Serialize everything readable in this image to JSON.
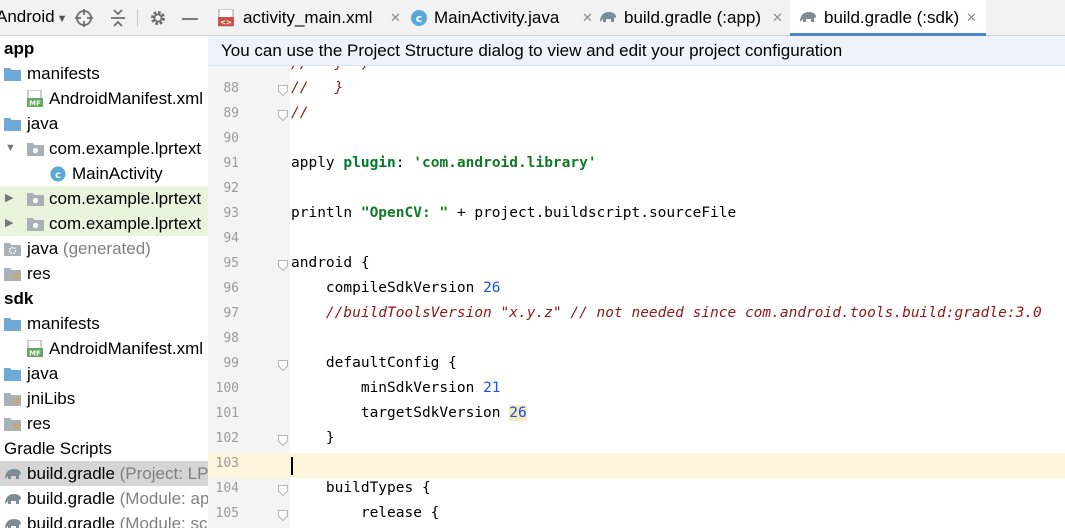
{
  "project_panel": {
    "view_selector": "Android",
    "tree": [
      {
        "label": "app",
        "bold": true
      },
      {
        "label": "manifests",
        "icon": "folder"
      },
      {
        "label": "AndroidManifest.xml",
        "icon": "manifest"
      },
      {
        "label": "java",
        "icon": "folder"
      },
      {
        "label": "com.example.lprtext",
        "icon": "package",
        "expanded": true
      },
      {
        "label": "MainActivity",
        "icon": "class"
      },
      {
        "label": "com.example.lprtext",
        "icon": "package",
        "expanded": false,
        "highlight": true
      },
      {
        "label": "com.example.lprtext",
        "icon": "package",
        "expanded": false,
        "highlight": true
      },
      {
        "label": "java",
        "suffix": "(generated)",
        "icon": "gen-folder"
      },
      {
        "label": "res",
        "icon": "res-folder"
      },
      {
        "label": "sdk",
        "bold": true
      },
      {
        "label": "manifests",
        "icon": "folder"
      },
      {
        "label": "AndroidManifest.xml",
        "icon": "manifest"
      },
      {
        "label": "java",
        "icon": "folder"
      },
      {
        "label": "jniLibs",
        "icon": "res-folder"
      },
      {
        "label": "res",
        "icon": "res-folder"
      },
      {
        "label": "Gradle Scripts"
      },
      {
        "label": "build.gradle",
        "suffix": "(Project: LP",
        "icon": "gradle",
        "selected": true
      },
      {
        "label": "build.gradle",
        "suffix": "(Module: ap",
        "icon": "gradle"
      },
      {
        "label": "build.gradle",
        "suffix": "(Module: sc",
        "icon": "gradle"
      }
    ]
  },
  "tabs": [
    {
      "label": "activity_main.xml",
      "icon": "layout"
    },
    {
      "label": "MainActivity.java",
      "icon": "class"
    },
    {
      "label": "build.gradle (:app)",
      "icon": "gradle"
    },
    {
      "label": "build.gradle (:sdk)",
      "icon": "gradle",
      "active": true
    }
  ],
  "banner": "You can use the Project Structure dialog to view and edit your project configuration",
  "editor": {
    "lines": [
      {
        "n": "88",
        "fold": true,
        "tokens": [
          [
            "cm",
            "//   }"
          ]
        ]
      },
      {
        "n": "89",
        "fold": true,
        "tokens": [
          [
            "cm",
            "//"
          ]
        ]
      },
      {
        "n": "90",
        "tokens": []
      },
      {
        "n": "91",
        "tokens": [
          [
            "pl",
            "apply "
          ],
          [
            "kw",
            "plugin"
          ],
          [
            "pl",
            ": "
          ],
          [
            "str",
            "'com.android.library'"
          ]
        ]
      },
      {
        "n": "92",
        "tokens": []
      },
      {
        "n": "93",
        "tokens": [
          [
            "pl",
            "println "
          ],
          [
            "str",
            "\"OpenCV: \""
          ],
          [
            "pl",
            " + project.buildscript.sourceFile"
          ]
        ]
      },
      {
        "n": "94",
        "tokens": []
      },
      {
        "n": "95",
        "fold": true,
        "tokens": [
          [
            "pl",
            "android {"
          ]
        ]
      },
      {
        "n": "96",
        "tokens": [
          [
            "pl",
            "    compileSdkVersion "
          ],
          [
            "num",
            "26"
          ]
        ]
      },
      {
        "n": "97",
        "tokens": [
          [
            "pl",
            "    "
          ],
          [
            "cm",
            "//buildToolsVersion \"x.y.z\" // not needed since com.android.tools.build:gradle:3.0"
          ]
        ]
      },
      {
        "n": "98",
        "tokens": []
      },
      {
        "n": "99",
        "fold": true,
        "tokens": [
          [
            "pl",
            "    defaultConfig {"
          ]
        ]
      },
      {
        "n": "100",
        "tokens": [
          [
            "pl",
            "        minSdkVersion "
          ],
          [
            "num",
            "21"
          ]
        ]
      },
      {
        "n": "101",
        "tokens": [
          [
            "pl",
            "        targetSdkVersion "
          ],
          [
            "numhl",
            "26"
          ]
        ]
      },
      {
        "n": "102",
        "fold": true,
        "tokens": [
          [
            "pl",
            "    }"
          ]
        ]
      },
      {
        "n": "103",
        "current": true,
        "tokens": []
      },
      {
        "n": "104",
        "fold": true,
        "tokens": [
          [
            "pl",
            "    buildTypes {"
          ]
        ]
      },
      {
        "n": "105",
        "fold": true,
        "tokens": [
          [
            "pl",
            "        release {"
          ]
        ]
      }
    ]
  },
  "colors": {
    "tab_underline": "#4a88c7",
    "selected_row": "#d5d5d5",
    "highlight_row": "#e8f5dc",
    "current_line": "#fdf5dc",
    "banner_bg": "#eef2fa"
  }
}
